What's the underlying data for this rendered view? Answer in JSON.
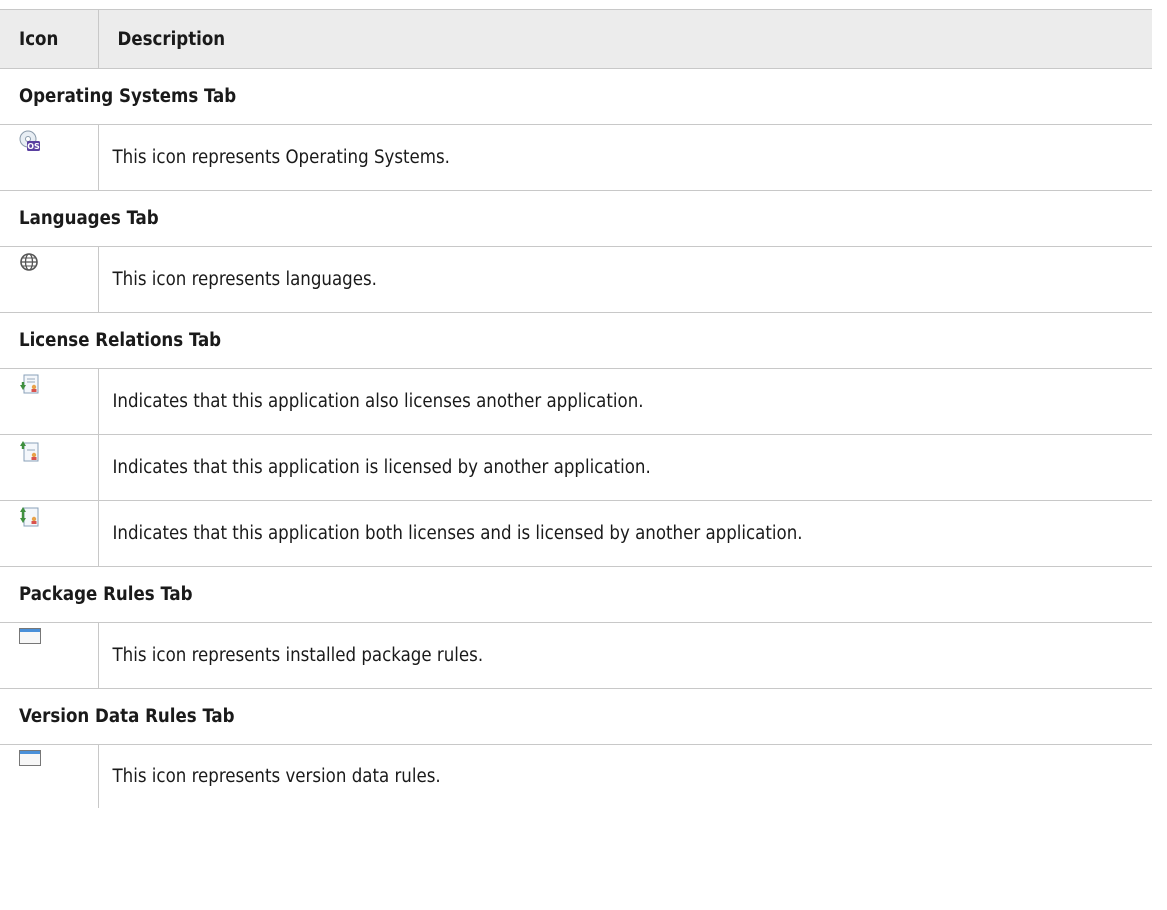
{
  "table": {
    "header": {
      "icon": "Icon",
      "description": "Description"
    },
    "sections": [
      {
        "title": "Operating Systems Tab",
        "rows": [
          {
            "icon": "os-disc-icon",
            "description": "This icon represents Operating Systems."
          }
        ]
      },
      {
        "title": "Languages Tab",
        "rows": [
          {
            "icon": "globe-icon",
            "description": "This icon represents languages."
          }
        ]
      },
      {
        "title": "License Relations Tab",
        "rows": [
          {
            "icon": "licenses-another-icon",
            "description": "Indicates that this application also licenses another application."
          },
          {
            "icon": "licensed-by-another-icon",
            "description": "Indicates that this application is licensed by another application."
          },
          {
            "icon": "licenses-both-icon",
            "description": "Indicates that this application both licenses and is licensed by another application."
          }
        ]
      },
      {
        "title": "Package Rules Tab",
        "rows": [
          {
            "icon": "window-icon",
            "description": "This icon represents installed package rules."
          }
        ]
      },
      {
        "title": "Version Data Rules Tab",
        "rows": [
          {
            "icon": "window-icon",
            "description": "This icon represents version data rules."
          }
        ]
      }
    ]
  },
  "colors": {
    "header_bg": "#ececec",
    "border": "#c8c8c8",
    "icon_purple": "#5a3fa0",
    "icon_green": "#3f8f3f",
    "icon_red": "#d9534f",
    "window_blue": "#4a90d9"
  }
}
